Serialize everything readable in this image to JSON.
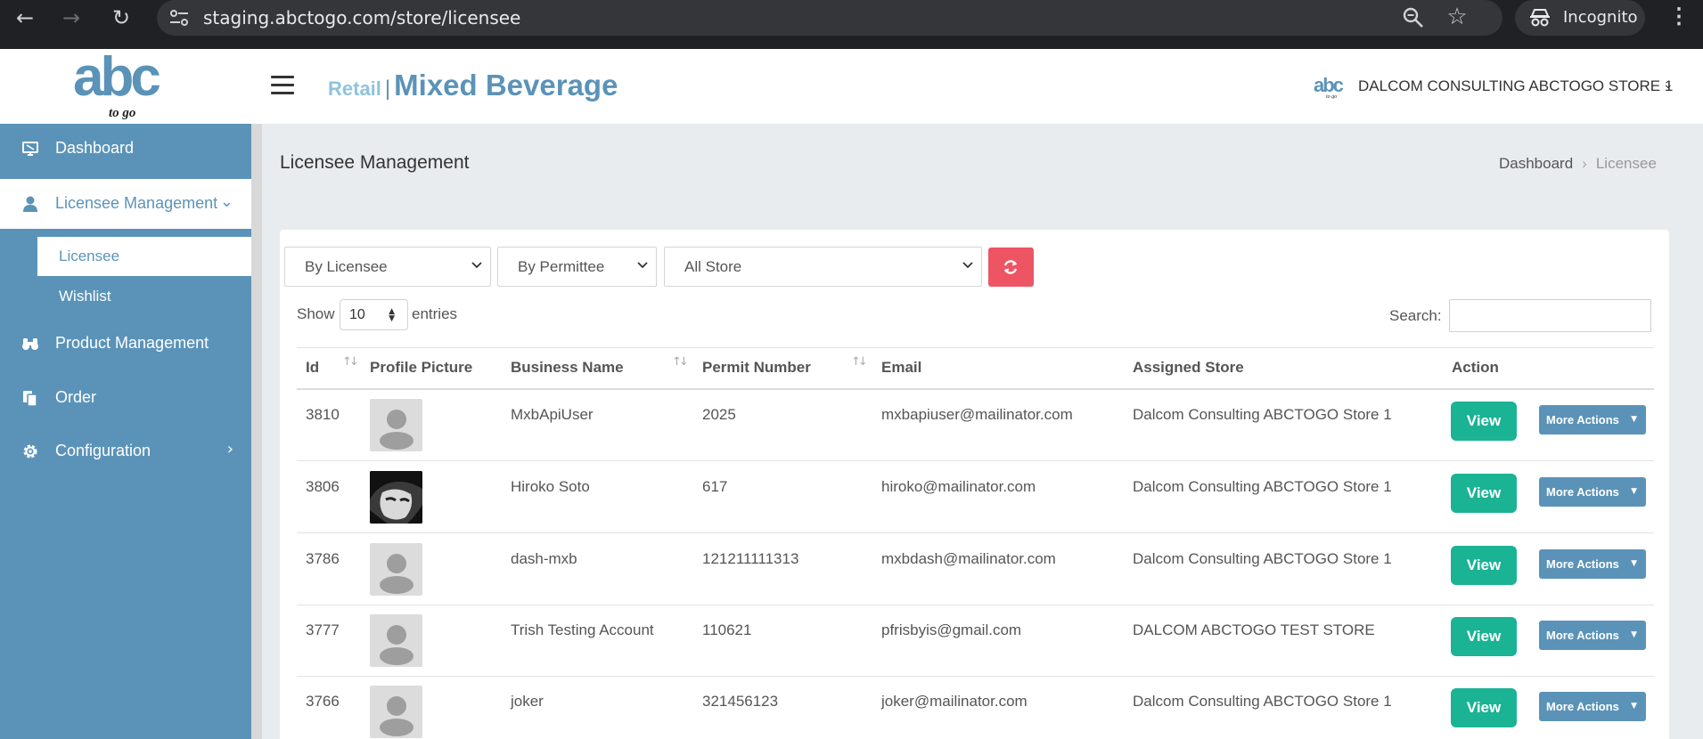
{
  "browser": {
    "url": "staging.abctogo.com/store/licensee",
    "incognito_label": "Incognito"
  },
  "header": {
    "logo_text": "abc",
    "logo_tagline": "to go",
    "brand_retail": "Retail",
    "brand_sep": "|",
    "brand_title": "Mixed Beverage",
    "store_name": "DALCOM CONSULTING ABCTOGO STORE 1"
  },
  "sidebar": {
    "dashboard": "Dashboard",
    "licensee_management": "Licensee Management",
    "sub_licensee": "Licensee",
    "sub_wishlist": "Wishlist",
    "product_management": "Product Management",
    "order": "Order",
    "configuration": "Configuration"
  },
  "page": {
    "title": "Licensee Management",
    "breadcrumb": [
      "Dashboard",
      "Licensee"
    ]
  },
  "filters": {
    "licensee": "By Licensee",
    "permittee": "By Permittee",
    "store": "All Store"
  },
  "table_controls": {
    "show": "Show",
    "page_length": "10",
    "entries": "entries",
    "search_label": "Search:"
  },
  "table": {
    "columns": [
      "Id",
      "Profile Picture",
      "Business Name",
      "Permit Number",
      "Email",
      "Assigned Store",
      "Action"
    ],
    "rows": [
      {
        "id": "3810",
        "business": "MxbApiUser",
        "permit": "2025",
        "email": "mxbapiuser@mailinator.com",
        "store": "Dalcom Consulting ABCTOGO Store 1",
        "picture": "placeholder"
      },
      {
        "id": "3806",
        "business": "Hiroko Soto",
        "permit": "617",
        "email": "hiroko@mailinator.com",
        "store": "Dalcom Consulting ABCTOGO Store 1",
        "picture": "photo"
      },
      {
        "id": "3786",
        "business": "dash-mxb",
        "permit": "121211111313",
        "email": "mxbdash@mailinator.com",
        "store": "Dalcom Consulting ABCTOGO Store 1",
        "picture": "placeholder"
      },
      {
        "id": "3777",
        "business": "Trish Testing Account",
        "permit": "110621",
        "email": "pfrisbyis@gmail.com",
        "store": "DALCOM ABCTOGO TEST STORE",
        "picture": "placeholder"
      },
      {
        "id": "3766",
        "business": "joker",
        "permit": "321456123",
        "email": "joker@mailinator.com",
        "store": "Dalcom Consulting ABCTOGO Store 1",
        "picture": "placeholder"
      }
    ],
    "view_label": "View",
    "more_actions_label": "More Actions"
  },
  "colors": {
    "brand_blue": "#5b93b8",
    "view_green": "#1ab394",
    "refresh_red": "#ed5565"
  }
}
